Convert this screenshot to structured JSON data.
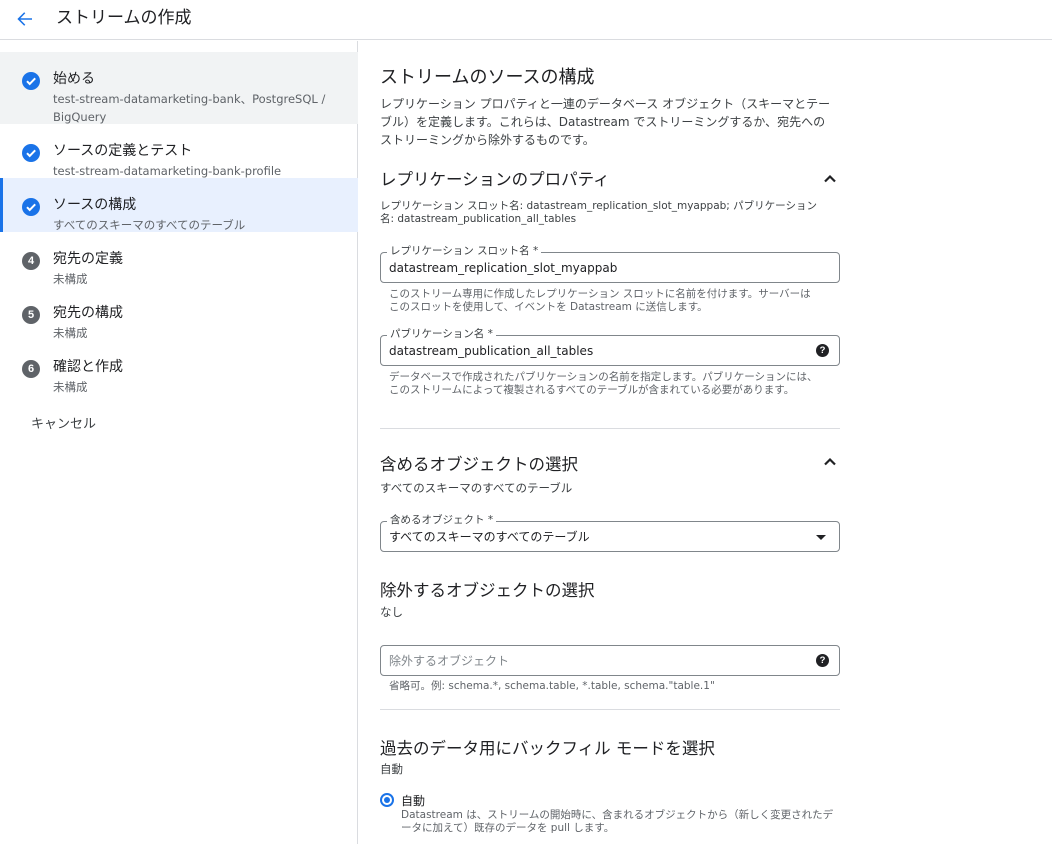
{
  "header": {
    "title": "ストリームの作成"
  },
  "sidebar": {
    "steps": [
      {
        "title": "始める",
        "subtitle": "test-stream-datamarketing-bank、PostgreSQL / BigQuery",
        "status": "done"
      },
      {
        "title": "ソースの定義とテスト",
        "subtitle": "test-stream-datamarketing-bank-profile",
        "status": "done"
      },
      {
        "title": "ソースの構成",
        "subtitle": "すべてのスキーマのすべてのテーブル",
        "status": "active"
      },
      {
        "title": "宛先の定義",
        "subtitle": "未構成",
        "number": "4"
      },
      {
        "title": "宛先の構成",
        "subtitle": "未構成",
        "number": "5"
      },
      {
        "title": "確認と作成",
        "subtitle": "未構成",
        "number": "6"
      }
    ],
    "cancel_label": "キャンセル"
  },
  "main": {
    "title": "ストリームのソースの構成",
    "description": "レプリケーション プロパティと一連のデータベース オブジェクト（スキーマとテーブル）を定義します。これらは、Datastream でストリーミングするか、宛先へのストリーミングから除外するものです。",
    "replication": {
      "heading": "レプリケーションのプロパティ",
      "summary": "レプリケーション スロット名: datastream_replication_slot_myappab; パブリケーション名: datastream_publication_all_tables",
      "slot_label": "レプリケーション スロット名 *",
      "slot_value": "datastream_replication_slot_myappab",
      "slot_helper": "このストリーム専用に作成したレプリケーション スロットに名前を付けます。サーバーはこのスロットを使用して、イベントを Datastream に送信します。",
      "publication_label": "パブリケーション名 *",
      "publication_value": "datastream_publication_all_tables",
      "publication_helper": "データベースで作成されたパブリケーションの名前を指定します。パブリケーションには、このストリームによって複製されるすべてのテーブルが含まれている必要があります。"
    },
    "include": {
      "heading": "含めるオブジェクトの選択",
      "summary": "すべてのスキーマのすべてのテーブル",
      "field_label": "含めるオブジェクト *",
      "field_value": "すべてのスキーマのすべてのテーブル"
    },
    "exclude": {
      "heading": "除外するオブジェクトの選択",
      "summary": "なし",
      "placeholder": "除外するオブジェクト",
      "helper": "省略可。例: schema.*, schema.table, *.table, schema.\"table.1\""
    },
    "backfill": {
      "heading": "過去のデータ用にバックフィル モードを選択",
      "summary": "自動",
      "option_label": "自動",
      "option_desc": "Datastream は、ストリームの開始時に、含まれるオブジェクトから（新しく変更されたデータに加えて）既存のデータを pull します。"
    }
  },
  "colors": {
    "accent": "#1a73e8",
    "active_bg": "#e8f0fe",
    "done_bg": "#f1f3f4",
    "divider": "#dadce0"
  }
}
